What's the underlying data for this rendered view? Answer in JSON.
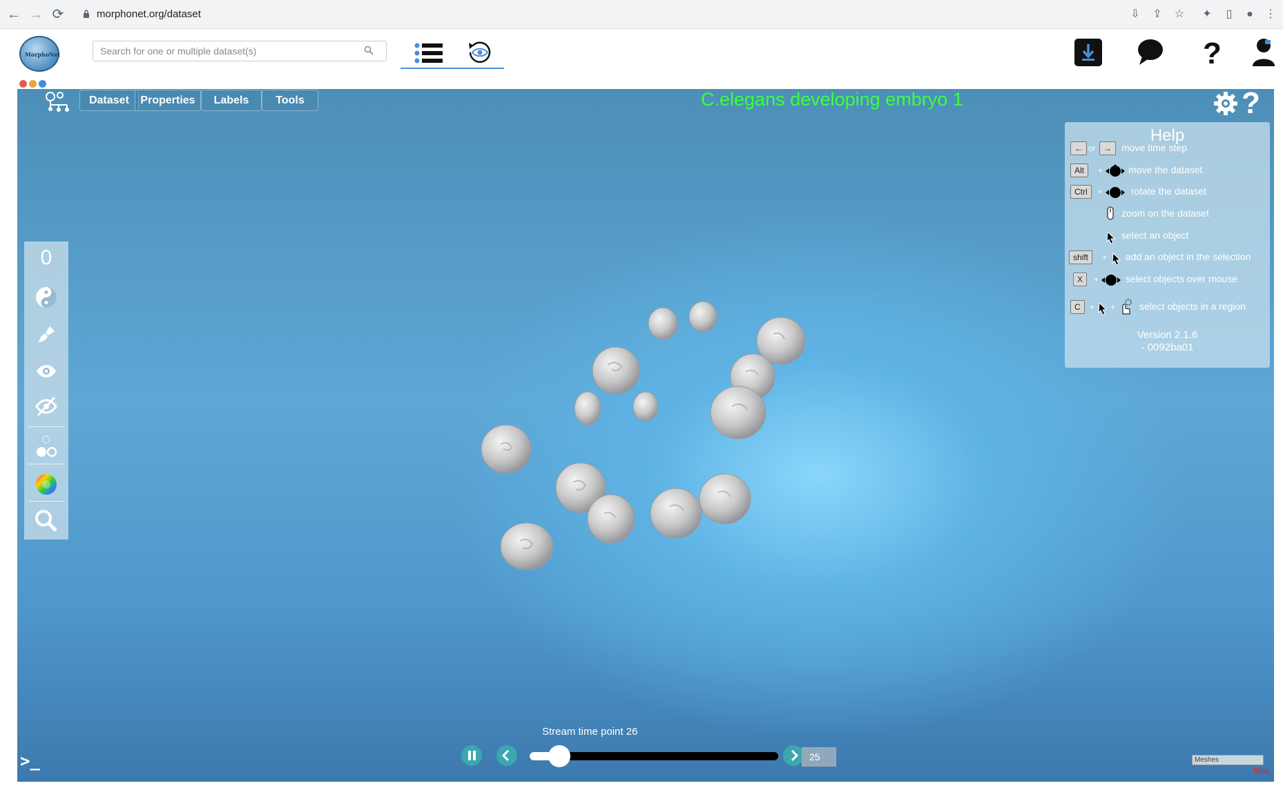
{
  "browser": {
    "url": "morphonet.org/dataset"
  },
  "header": {
    "search_placeholder": "Search for one or multiple dataset(s)",
    "logo_text": "MorphoNet"
  },
  "viewer": {
    "menu": [
      "Dataset",
      "Properties",
      "Labels",
      "Tools"
    ],
    "title": "C.elegans developing embryo 1",
    "title_color": "#3dff3d",
    "sidebar_counter": "0"
  },
  "help": {
    "title": "Help",
    "rows": [
      {
        "keys": [
          "←",
          "→"
        ],
        "sep": "or",
        "desc": "move time step"
      },
      {
        "keys": [
          "Alt"
        ],
        "desc": "move the dataset"
      },
      {
        "keys": [
          "Ctrl"
        ],
        "desc": "rotate the dataset"
      },
      {
        "keys": [],
        "desc": "zoom on the dataset"
      },
      {
        "keys": [],
        "desc": "select an object"
      },
      {
        "keys": [
          "shift"
        ],
        "desc": "add an object in the selection"
      },
      {
        "keys": [
          "X"
        ],
        "desc": "select objects over mouse"
      },
      {
        "keys": [
          "C"
        ],
        "desc": "select objects in a region"
      }
    ],
    "version_line1": "Version 2.1.6",
    "version_line2": "- 0092ba01"
  },
  "timeline": {
    "label": "Stream time point 26",
    "value": "25",
    "slider_fraction": 0.12
  },
  "status": {
    "meshes_label": "Meshes",
    "fps": "6fps"
  },
  "colors": {
    "accent": "#4a8fd8",
    "control_teal": "#3ba7b0"
  }
}
